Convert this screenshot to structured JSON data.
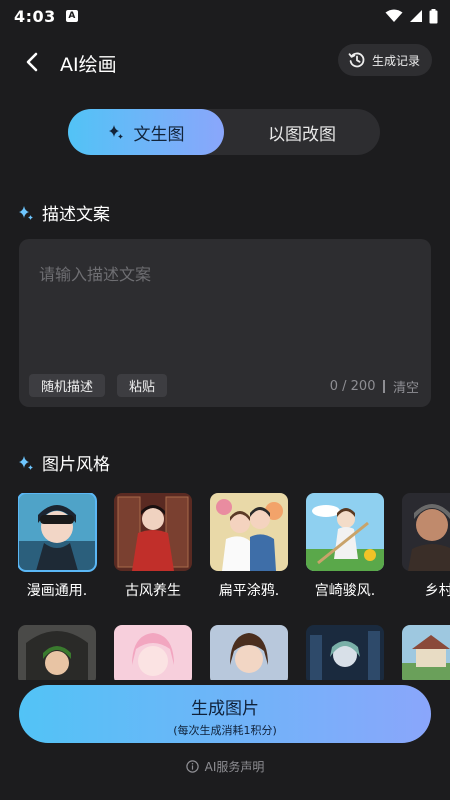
{
  "status_bar": {
    "time": "4:03",
    "badge": "A"
  },
  "header": {
    "title": "AI绘画",
    "history_label": "生成记录"
  },
  "tabs": [
    {
      "label": "文生图",
      "active": true
    },
    {
      "label": "以图改图",
      "active": false
    }
  ],
  "description": {
    "section_title": "描述文案",
    "placeholder": "请输入描述文案",
    "random_label": "随机描述",
    "paste_label": "粘贴",
    "counter": "0 / 200",
    "clear_label": "清空"
  },
  "styles": {
    "section_title": "图片风格",
    "items": [
      {
        "label": "漫画通用.",
        "selected": true
      },
      {
        "label": "古风养生",
        "selected": false
      },
      {
        "label": "扁平涂鸦.",
        "selected": false
      },
      {
        "label": "宫崎骏风.",
        "selected": false
      },
      {
        "label": "乡村.",
        "selected": false
      }
    ]
  },
  "generate": {
    "label": "生成图片",
    "sub": "(每次生成消耗1积分)"
  },
  "footer": {
    "disclaimer": "AI服务声明"
  },
  "colors": {
    "background": "#1c1c1e",
    "accent_start": "#52c3f6",
    "accent_end": "#8aa6fb"
  }
}
